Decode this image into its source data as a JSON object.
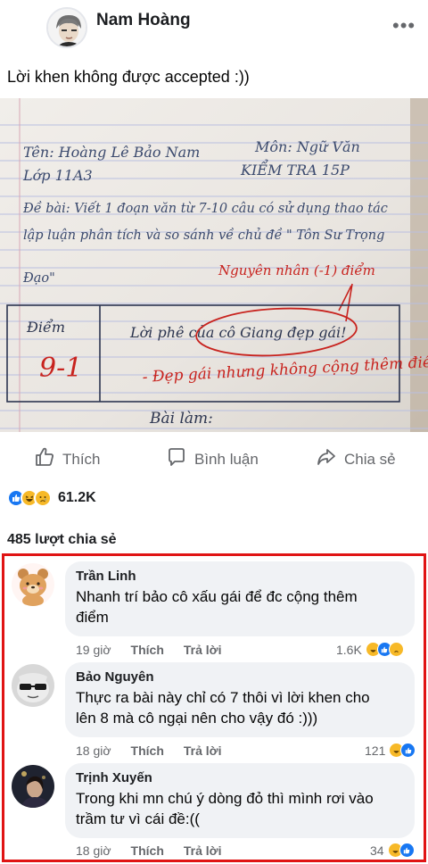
{
  "post": {
    "author": "Nam Hoàng",
    "caption": "Lời khen không được accepted :))",
    "more_icon": "more-dots-icon",
    "photo": {
      "name_line": "Tên: Hoàng Lê Bảo Nam",
      "class_line": "Lớp 11A3",
      "subject_line": "Môn: Ngữ Văn",
      "test_line": "KIỂM TRA 15P",
      "prompt_line1": "Đề bài: Viết 1 đoạn văn từ 7-10 câu có sử dụng thao tác",
      "prompt_line2": "lập luận phân tích và so sánh về chủ đề \" Tôn Sư Trọng",
      "prompt_line3": "Đạo\"",
      "deduction_note": "Nguyên nhân (-1) điểm",
      "score_label": "Điểm",
      "score_value": "9-1",
      "comment_label": "Lời phê của cô Giang đẹp gái!",
      "red_remark": "- Đẹp gái nhưng không cộng thêm điểm đ",
      "work_label": "Bài làm:"
    }
  },
  "actions": {
    "like": "Thích",
    "comment": "Bình luận",
    "share": "Chia sẻ"
  },
  "reactions": {
    "icons": [
      "like-reaction-icon",
      "haha-reaction-icon",
      "sad-reaction-icon"
    ],
    "count": "61.2K"
  },
  "shares_text": "485 lượt chia sẻ",
  "colors": {
    "like_blue": "#1877f2",
    "haha_yellow": "#f7b928",
    "highlight_red": "#e01414",
    "bubble_gray": "#f0f2f5",
    "meta_gray": "#65676b"
  },
  "comments": [
    {
      "name": "Trần Linh",
      "text_line1": "Nhanh trí bảo cô xấu gái để đc cộng thêm",
      "text_line2": "điểm",
      "time": "19 giờ",
      "like": "Thích",
      "reply": "Trả lời",
      "count": "1.6K",
      "reaction_icons": [
        "haha-reaction-icon",
        "like-reaction-icon",
        "sad-reaction-icon"
      ]
    },
    {
      "name": "Bảo Nguyên",
      "text_line1": "Thực ra bài này chỉ có 7 thôi vì lời khen cho",
      "text_line2": "lên 8 mà cô ngại nên cho vậy đó :)))",
      "time": "18 giờ",
      "like": "Thích",
      "reply": "Trả lời",
      "count": "121",
      "reaction_icons": [
        "haha-reaction-icon",
        "like-reaction-icon"
      ]
    },
    {
      "name": "Trịnh Xuyến",
      "text_line1": "Trong khi mn chú ý dòng đỏ thì mình rơi vào",
      "text_line2": "trầm tư vì cái đề:((",
      "time": "18 giờ",
      "like": "Thích",
      "reply": "Trả lời",
      "count": "34",
      "reaction_icons": [
        "haha-reaction-icon",
        "like-reaction-icon"
      ]
    }
  ]
}
